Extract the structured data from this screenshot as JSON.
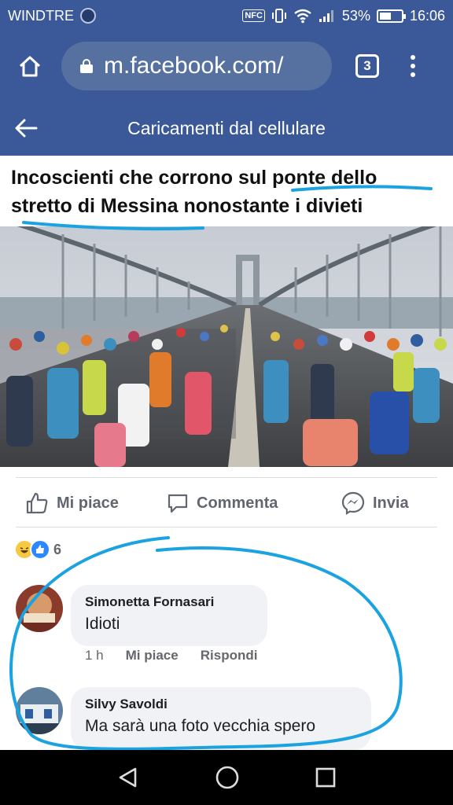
{
  "status_bar": {
    "carrier": "WINDTRE",
    "nfc": "NFC",
    "battery": "53%",
    "battery_level": 0.53,
    "time": "16:06"
  },
  "browser": {
    "url": "m.facebook.com/",
    "tab_count": "3"
  },
  "header": {
    "title": "Caricamenti dal cellulare"
  },
  "post": {
    "caption_line1": "Incoscienti che corrono sul ponte dello",
    "caption_line2": "stretto di Messina nonostante i divieti"
  },
  "actions": {
    "like": "Mi piace",
    "comment": "Commenta",
    "share": "Invia"
  },
  "reactions": {
    "icons": [
      "haha-icon",
      "like-icon"
    ],
    "count": "6"
  },
  "comments": [
    {
      "author": "Simonetta Fornasari",
      "text": "Idioti",
      "time": "1 h",
      "like": "Mi piace",
      "reply": "Rispondi"
    },
    {
      "author": "Silvy Savoldi",
      "text": "Ma sarà una foto vecchia spero"
    }
  ],
  "colors": {
    "facebook_blue": "#3b5998",
    "annotation_blue": "#1aa3e0",
    "action_gray": "#606770"
  }
}
